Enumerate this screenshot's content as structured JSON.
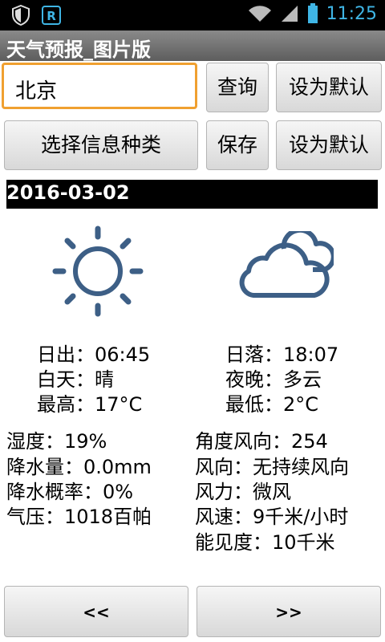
{
  "status_bar": {
    "time": "11:25"
  },
  "app": {
    "title": "天气预报_图片版"
  },
  "controls": {
    "city_value": "北京",
    "query_label": "查询",
    "set_default_label_1": "设为默认",
    "select_type_label": "选择信息种类",
    "save_label": "保存",
    "set_default_label_2": "设为默认"
  },
  "forecast": {
    "date": "2016-03-02",
    "day_icon": "sun-icon",
    "night_icon": "cloud-icon",
    "sunrise": "日出：06:45",
    "sunset": "日落：18:07",
    "day_weather": "白天：晴",
    "night_weather": "夜晚：多云",
    "high": "最高：17°C",
    "low": "最低：2°C"
  },
  "details": {
    "humidity": "湿度：19%",
    "precipitation": "降水量：0.0mm",
    "precip_probability": "降水概率：0%",
    "pressure": "气压：1018百帕",
    "wind_angle": "角度风向：254",
    "wind_direction": "风向：无持续风向",
    "wind_force": "风力：微风",
    "wind_speed": "风速：9千米/小时",
    "visibility": "能见度：10千米"
  },
  "nav": {
    "prev_label": "<<",
    "next_label": ">>"
  },
  "colors": {
    "icon_blue": "#3d5f86",
    "focus_orange": "#f0a030",
    "time_blue": "#3fb5e5"
  }
}
